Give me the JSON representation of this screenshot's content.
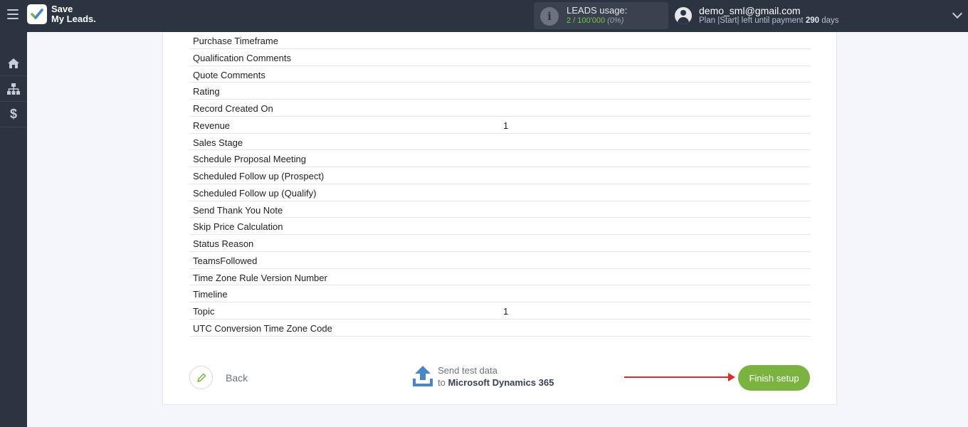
{
  "header": {
    "logo_line1": "Save",
    "logo_line2": "My Leads.",
    "usage_title": "LEADS usage:",
    "usage_count": "2 / 100'000",
    "usage_percent": "(0%)",
    "user_email": "demo_sml@gmail.com",
    "plan_prefix": "Plan |Start| left until payment ",
    "plan_days": "290",
    "plan_suffix": " days"
  },
  "sidebar": {
    "items": [
      {
        "icon": "home-icon"
      },
      {
        "icon": "sitemap-icon"
      },
      {
        "icon": "dollar-icon",
        "glyph": "$"
      }
    ]
  },
  "fields": [
    {
      "label": "Purchase Timeframe",
      "value": ""
    },
    {
      "label": "Qualification Comments",
      "value": ""
    },
    {
      "label": "Quote Comments",
      "value": ""
    },
    {
      "label": "Rating",
      "value": ""
    },
    {
      "label": "Record Created On",
      "value": ""
    },
    {
      "label": "Revenue",
      "value": "1"
    },
    {
      "label": "Sales Stage",
      "value": ""
    },
    {
      "label": "Schedule Proposal Meeting",
      "value": ""
    },
    {
      "label": "Scheduled Follow up (Prospect)",
      "value": ""
    },
    {
      "label": "Scheduled Follow up (Qualify)",
      "value": ""
    },
    {
      "label": "Send Thank You Note",
      "value": ""
    },
    {
      "label": "Skip Price Calculation",
      "value": ""
    },
    {
      "label": "Status Reason",
      "value": ""
    },
    {
      "label": "TeamsFollowed",
      "value": ""
    },
    {
      "label": "Time Zone Rule Version Number",
      "value": ""
    },
    {
      "label": "Timeline",
      "value": ""
    },
    {
      "label": "Topic",
      "value": "1"
    },
    {
      "label": "UTC Conversion Time Zone Code",
      "value": ""
    }
  ],
  "footer": {
    "back_label": "Back",
    "send_line1": "Send test data",
    "send_to": "to ",
    "send_target": "Microsoft Dynamics 365",
    "finish_label": "Finish setup"
  },
  "colors": {
    "topbar": "#2c3442",
    "accent_green": "#7bb340",
    "arrow_red": "#e12b2b",
    "send_icon_blue": "#4a86c5"
  }
}
